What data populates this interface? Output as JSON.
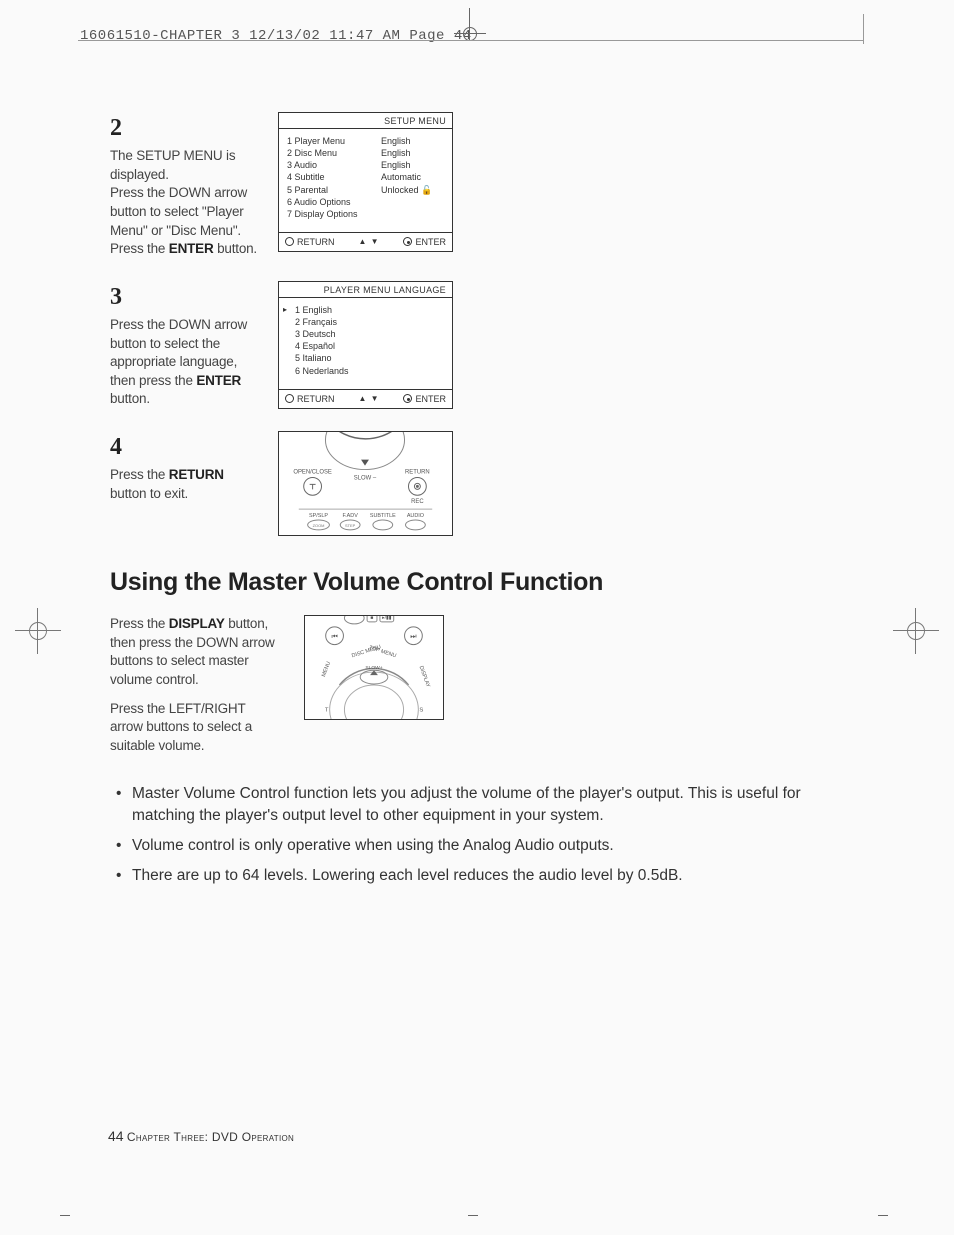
{
  "print_header": "16061510-CHAPTER 3  12/13/02 11:47 AM  Page 44",
  "steps": {
    "s2": {
      "num": "2",
      "line1": "The SETUP MENU is displayed.",
      "line2a": "Press the DOWN arrow button to select \"Player Menu\" or \"Disc Menu\".",
      "line3a": "Press the ",
      "line3b": "ENTER",
      "line3c": " button."
    },
    "s3": {
      "num": "3",
      "line1a": "Press the DOWN arrow button to select the appropriate language, then press the ",
      "line1b": "ENTER",
      "line1c": " button."
    },
    "s4": {
      "num": "4",
      "line1a": "Press the ",
      "line1b": "RETURN",
      "line1c": " button to exit."
    }
  },
  "screen1": {
    "title": "SETUP  MENU",
    "rows": [
      {
        "l": "1  Player Menu",
        "r": "English"
      },
      {
        "l": "2  Disc Menu",
        "r": "English"
      },
      {
        "l": "3  Audio",
        "r": "English"
      },
      {
        "l": "4  Subtitle",
        "r": "Automatic"
      },
      {
        "l": "5  Parental",
        "r": "Unlocked"
      },
      {
        "l": "6  Audio Options",
        "r": ""
      },
      {
        "l": "7  Display Options",
        "r": ""
      }
    ],
    "footer": {
      "return": "RETURN",
      "arrows": "▲ ▼",
      "enter": "ENTER"
    }
  },
  "screen2": {
    "title": "PLAYER MENU LANGUAGE",
    "rows": [
      "1  English",
      "2  Français",
      "3  Deutsch",
      "4  Español",
      "5  Italiano",
      "6  Nederlands"
    ],
    "footer": {
      "return": "RETURN",
      "arrows": "▲ ▼",
      "enter": "ENTER"
    }
  },
  "remote1_labels": {
    "open_close": "OPEN/CLOSE",
    "slow": "SLOW –",
    "return": "RETURN",
    "rec": "REC",
    "sp": "SP/SLP",
    "fadv": "F.ADV",
    "subtitle": "SUBTITLE",
    "audio": "AUDIO",
    "zoom": "ZOOM",
    "step": "STEP"
  },
  "section_title": "Using the Master Volume Control Function",
  "mv": {
    "p1a": "Press the ",
    "p1b": "DISPLAY",
    "p1c": " button, then press the DOWN arrow buttons to select master volume control.",
    "p2": "Press the LEFT/RIGHT arrow buttons to select a suitable volume."
  },
  "remote2_labels": {
    "disc_menu": "DISC MENU",
    "top_menu": "TOP MENU",
    "menu": "MENU",
    "display": "DISPLAY",
    "slow": "SLOW+",
    "t": "T",
    "s": "S"
  },
  "bullets": [
    "Master Volume Control function lets you adjust the volume of the player's output. This is useful for matching the player's output level to other equipment in your system.",
    "Volume control is only operative when using the Analog Audio outputs.",
    "There are up to 64 levels. Lowering each level reduces the audio level by 0.5dB."
  ],
  "footer": {
    "page_num": "44",
    "chapter": "Chapter Three: DVD Operation"
  }
}
